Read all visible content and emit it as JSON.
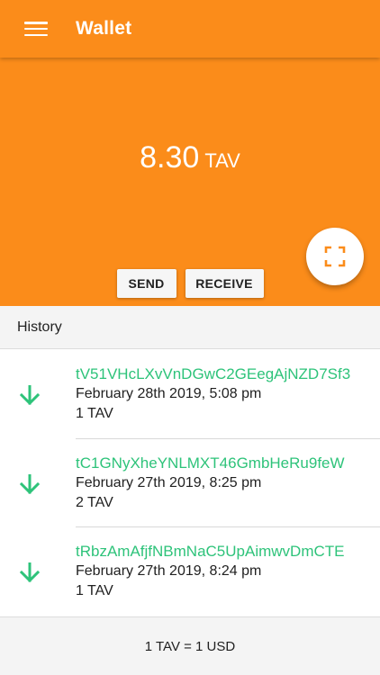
{
  "appbar": {
    "title": "Wallet",
    "menu_icon": "hamburger-menu-icon"
  },
  "balance": {
    "amount": "8.30",
    "unit": "TAV"
  },
  "actions": {
    "send_label": "SEND",
    "receive_label": "RECEIVE",
    "scan_icon": "qr-scan-icon"
  },
  "history": {
    "header": "History",
    "items": [
      {
        "address": "tV51VHcLXvVnDGwC2GEegAjNZD7Sf3",
        "date": "February 28th 2019, 5:08 pm",
        "amount": "1 TAV",
        "direction": "incoming"
      },
      {
        "address": "tC1GNyXheYNLMXT46GmbHeRu9feW",
        "date": "February 27th 2019, 8:25 pm",
        "amount": "2 TAV",
        "direction": "incoming"
      },
      {
        "address": "tRbzAmAfjfNBmNaC5UpAimwvDmCTE",
        "date": "February 27th 2019, 8:24 pm",
        "amount": "1 TAV",
        "direction": "incoming"
      }
    ]
  },
  "footer": {
    "rate": "1 TAV = 1 USD"
  },
  "colors": {
    "primary": "#fb8c1a",
    "incoming": "#2ec37a"
  }
}
